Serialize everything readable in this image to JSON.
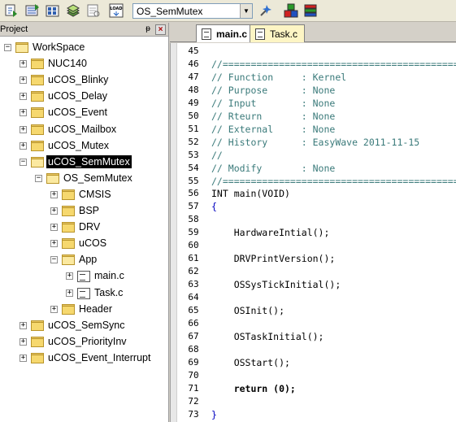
{
  "toolbar": {
    "buttons": [
      {
        "name": "translate-icon"
      },
      {
        "name": "build-icon"
      },
      {
        "name": "rebuild-icon"
      },
      {
        "name": "batch-build-icon"
      },
      {
        "name": "stop-build-icon"
      },
      {
        "name": "load-icon",
        "label": "LOAD"
      }
    ],
    "target": "OS_SemMutex",
    "right_buttons": [
      {
        "name": "target-options-icon"
      },
      {
        "name": "manage-components-icon"
      },
      {
        "name": "select-packs-icon"
      }
    ]
  },
  "project": {
    "title": "Project",
    "pin": "ᵽ",
    "close": "×",
    "nodes": [
      {
        "label": "WorkSpace",
        "level": 0,
        "exp": "−",
        "icon": "folder-open"
      },
      {
        "label": "NUC140",
        "level": 1,
        "exp": "+",
        "icon": "folder"
      },
      {
        "label": "uCOS_Blinky",
        "level": 1,
        "exp": "+",
        "icon": "folder"
      },
      {
        "label": "uCOS_Delay",
        "level": 1,
        "exp": "+",
        "icon": "folder"
      },
      {
        "label": "uCOS_Event",
        "level": 1,
        "exp": "+",
        "icon": "folder"
      },
      {
        "label": "uCOS_Mailbox",
        "level": 1,
        "exp": "+",
        "icon": "folder"
      },
      {
        "label": "uCOS_Mutex",
        "level": 1,
        "exp": "+",
        "icon": "folder"
      },
      {
        "label": "uCOS_SemMutex",
        "level": 1,
        "exp": "−",
        "icon": "folder-open",
        "selected": true
      },
      {
        "label": "OS_SemMutex",
        "level": 2,
        "exp": "−",
        "icon": "folder-open"
      },
      {
        "label": "CMSIS",
        "level": 3,
        "exp": "+",
        "icon": "folder"
      },
      {
        "label": "BSP",
        "level": 3,
        "exp": "+",
        "icon": "folder"
      },
      {
        "label": "DRV",
        "level": 3,
        "exp": "+",
        "icon": "folder"
      },
      {
        "label": "uCOS",
        "level": 3,
        "exp": "+",
        "icon": "folder"
      },
      {
        "label": "App",
        "level": 3,
        "exp": "−",
        "icon": "folder-open"
      },
      {
        "label": "main.c",
        "level": 4,
        "exp": "+",
        "icon": "file"
      },
      {
        "label": "Task.c",
        "level": 4,
        "exp": "+",
        "icon": "file"
      },
      {
        "label": "Header",
        "level": 3,
        "exp": "+",
        "icon": "folder"
      },
      {
        "label": "uCOS_SemSync",
        "level": 1,
        "exp": "+",
        "icon": "folder"
      },
      {
        "label": "uCOS_PriorityInv",
        "level": 1,
        "exp": "+",
        "icon": "folder"
      },
      {
        "label": "uCOS_Event_Interrupt",
        "level": 1,
        "exp": "+",
        "icon": "folder"
      }
    ]
  },
  "tabs": [
    {
      "label": "main.c",
      "active": true
    },
    {
      "label": "Task.c",
      "active": false
    }
  ],
  "code": [
    {
      "n": "45",
      "t": "",
      "c": "plain"
    },
    {
      "n": "46",
      "t": "//==========================================",
      "c": "cm"
    },
    {
      "n": "47",
      "t": "// Function     : Kernel",
      "c": "cm"
    },
    {
      "n": "48",
      "t": "// Purpose      : None",
      "c": "cm"
    },
    {
      "n": "49",
      "t": "// Input        : None",
      "c": "cm"
    },
    {
      "n": "50",
      "t": "// Rteurn       : None",
      "c": "cm"
    },
    {
      "n": "51",
      "t": "// External     : None",
      "c": "cm"
    },
    {
      "n": "52",
      "t": "// History      : EasyWave 2011-11-15",
      "c": "cm"
    },
    {
      "n": "53",
      "t": "//",
      "c": "cm"
    },
    {
      "n": "54",
      "t": "// Modify       : None",
      "c": "cm"
    },
    {
      "n": "55",
      "t": "//==========================================",
      "c": "cm"
    },
    {
      "n": "56",
      "t": "INT main(VOID)",
      "c": "plain"
    },
    {
      "n": "57",
      "t": "{",
      "c": "pn"
    },
    {
      "n": "58",
      "t": "",
      "c": "plain"
    },
    {
      "n": "59",
      "t": "    HardwareIntial();",
      "c": "call"
    },
    {
      "n": "60",
      "t": "",
      "c": "plain"
    },
    {
      "n": "61",
      "t": "    DRVPrintVersion();",
      "c": "call"
    },
    {
      "n": "62",
      "t": "",
      "c": "plain"
    },
    {
      "n": "63",
      "t": "    OSSysTickInitial();",
      "c": "call"
    },
    {
      "n": "64",
      "t": "",
      "c": "plain"
    },
    {
      "n": "65",
      "t": "    OSInit();",
      "c": "call"
    },
    {
      "n": "66",
      "t": "",
      "c": "plain"
    },
    {
      "n": "67",
      "t": "    OSTaskInitial();",
      "c": "call"
    },
    {
      "n": "68",
      "t": "",
      "c": "plain"
    },
    {
      "n": "69",
      "t": "    OSStart();",
      "c": "call"
    },
    {
      "n": "70",
      "t": "",
      "c": "plain"
    },
    {
      "n": "71",
      "t": "    return (0);",
      "c": "ret"
    },
    {
      "n": "72",
      "t": "",
      "c": "plain"
    },
    {
      "n": "73",
      "t": "}",
      "c": "pn"
    }
  ]
}
